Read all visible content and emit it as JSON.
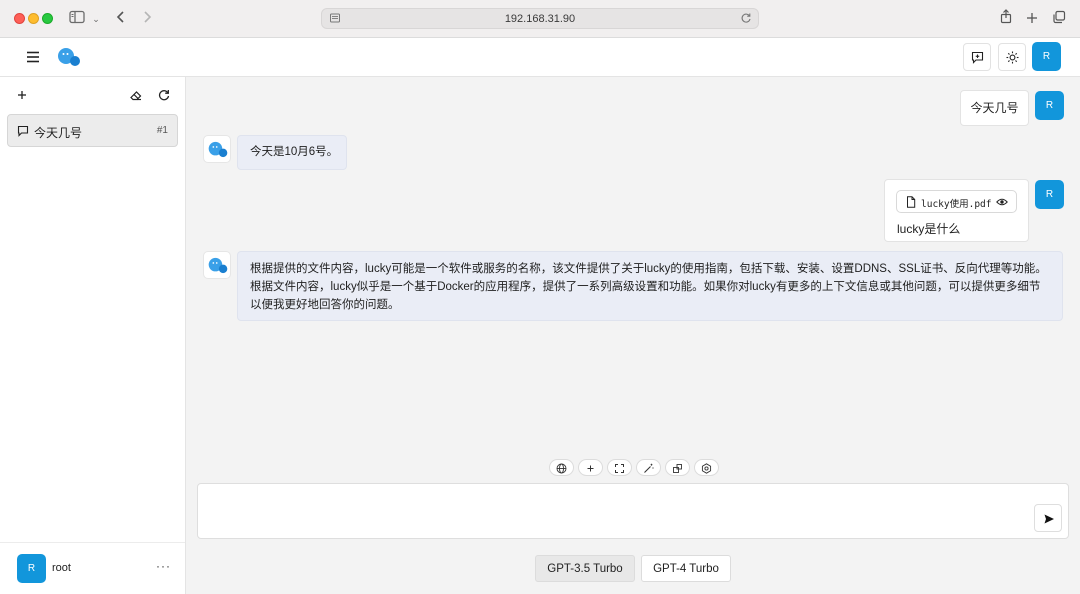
{
  "browser": {
    "url": "192.168.31.90"
  },
  "header": {
    "user_avatar": "R"
  },
  "sidebar": {
    "chats": [
      {
        "title": "今天几号",
        "number": "#1"
      }
    ],
    "user": {
      "avatar": "R",
      "name": "root",
      "more": "···"
    }
  },
  "messages": [
    {
      "role": "user",
      "avatar": "R",
      "text": "今天几号"
    },
    {
      "role": "assistant",
      "text": "今天是10月6号。"
    },
    {
      "role": "user",
      "avatar": "R",
      "attachment": "lucky使用.pdf",
      "text": "lucky是什么"
    },
    {
      "role": "assistant",
      "text": "根据提供的文件内容，lucky可能是一个软件或服务的名称，该文件提供了关于lucky的使用指南，包括下载、安装、设置DDNS、SSL证书、反向代理等功能。根据文件内容，lucky似乎是一个基于Docker的应用程序，提供了一系列高级设置和功能。如果你对lucky有更多的上下文信息或其他问题，可以提供更多细节以便我更好地回答你的问题。"
    }
  ],
  "composer": {
    "input_value": "",
    "toolbar_icons": [
      "globe-icon",
      "plus-icon",
      "fullscreen-icon",
      "magic-wand-icon",
      "plugin-icon",
      "settings-icon"
    ]
  },
  "models": [
    {
      "label": "GPT-3.5 Turbo",
      "selected": true
    },
    {
      "label": "GPT-4 Turbo",
      "selected": false
    }
  ],
  "colors": {
    "accent": "#1296db",
    "ai_bubble": "#eaedf6",
    "selected_model": "#e8e8e8"
  }
}
